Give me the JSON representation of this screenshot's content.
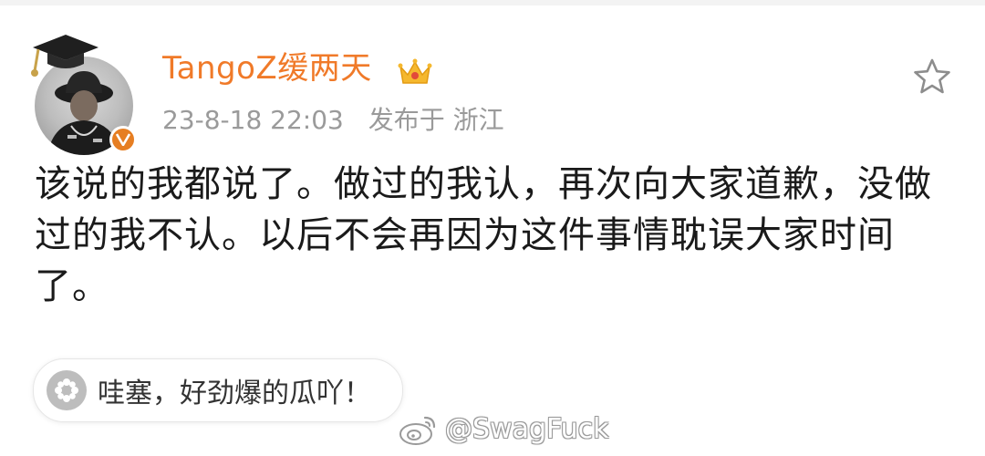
{
  "post": {
    "username": "TangoZ缓两天",
    "date": "23-8-18 22:03",
    "location": "发布于 浙江",
    "text": "该说的我都说了。做过的我认，再次向大家道歉，没做过的我不认。以后不会再因为这件事情耽误大家时间了。"
  },
  "bubble": {
    "text": "哇塞，好劲爆的瓜吖！"
  },
  "watermark": {
    "text": "@SwagFuck"
  },
  "icons": {
    "avatar_badge": "verified-v-icon",
    "crown": "crown-icon",
    "favorite": "star-outline-icon",
    "bubble": "flower-icon",
    "watermark": "weibo-logo-icon"
  },
  "colors": {
    "username": "#f07a29",
    "meta": "#9a9a9a",
    "badge": "#e67e22"
  }
}
